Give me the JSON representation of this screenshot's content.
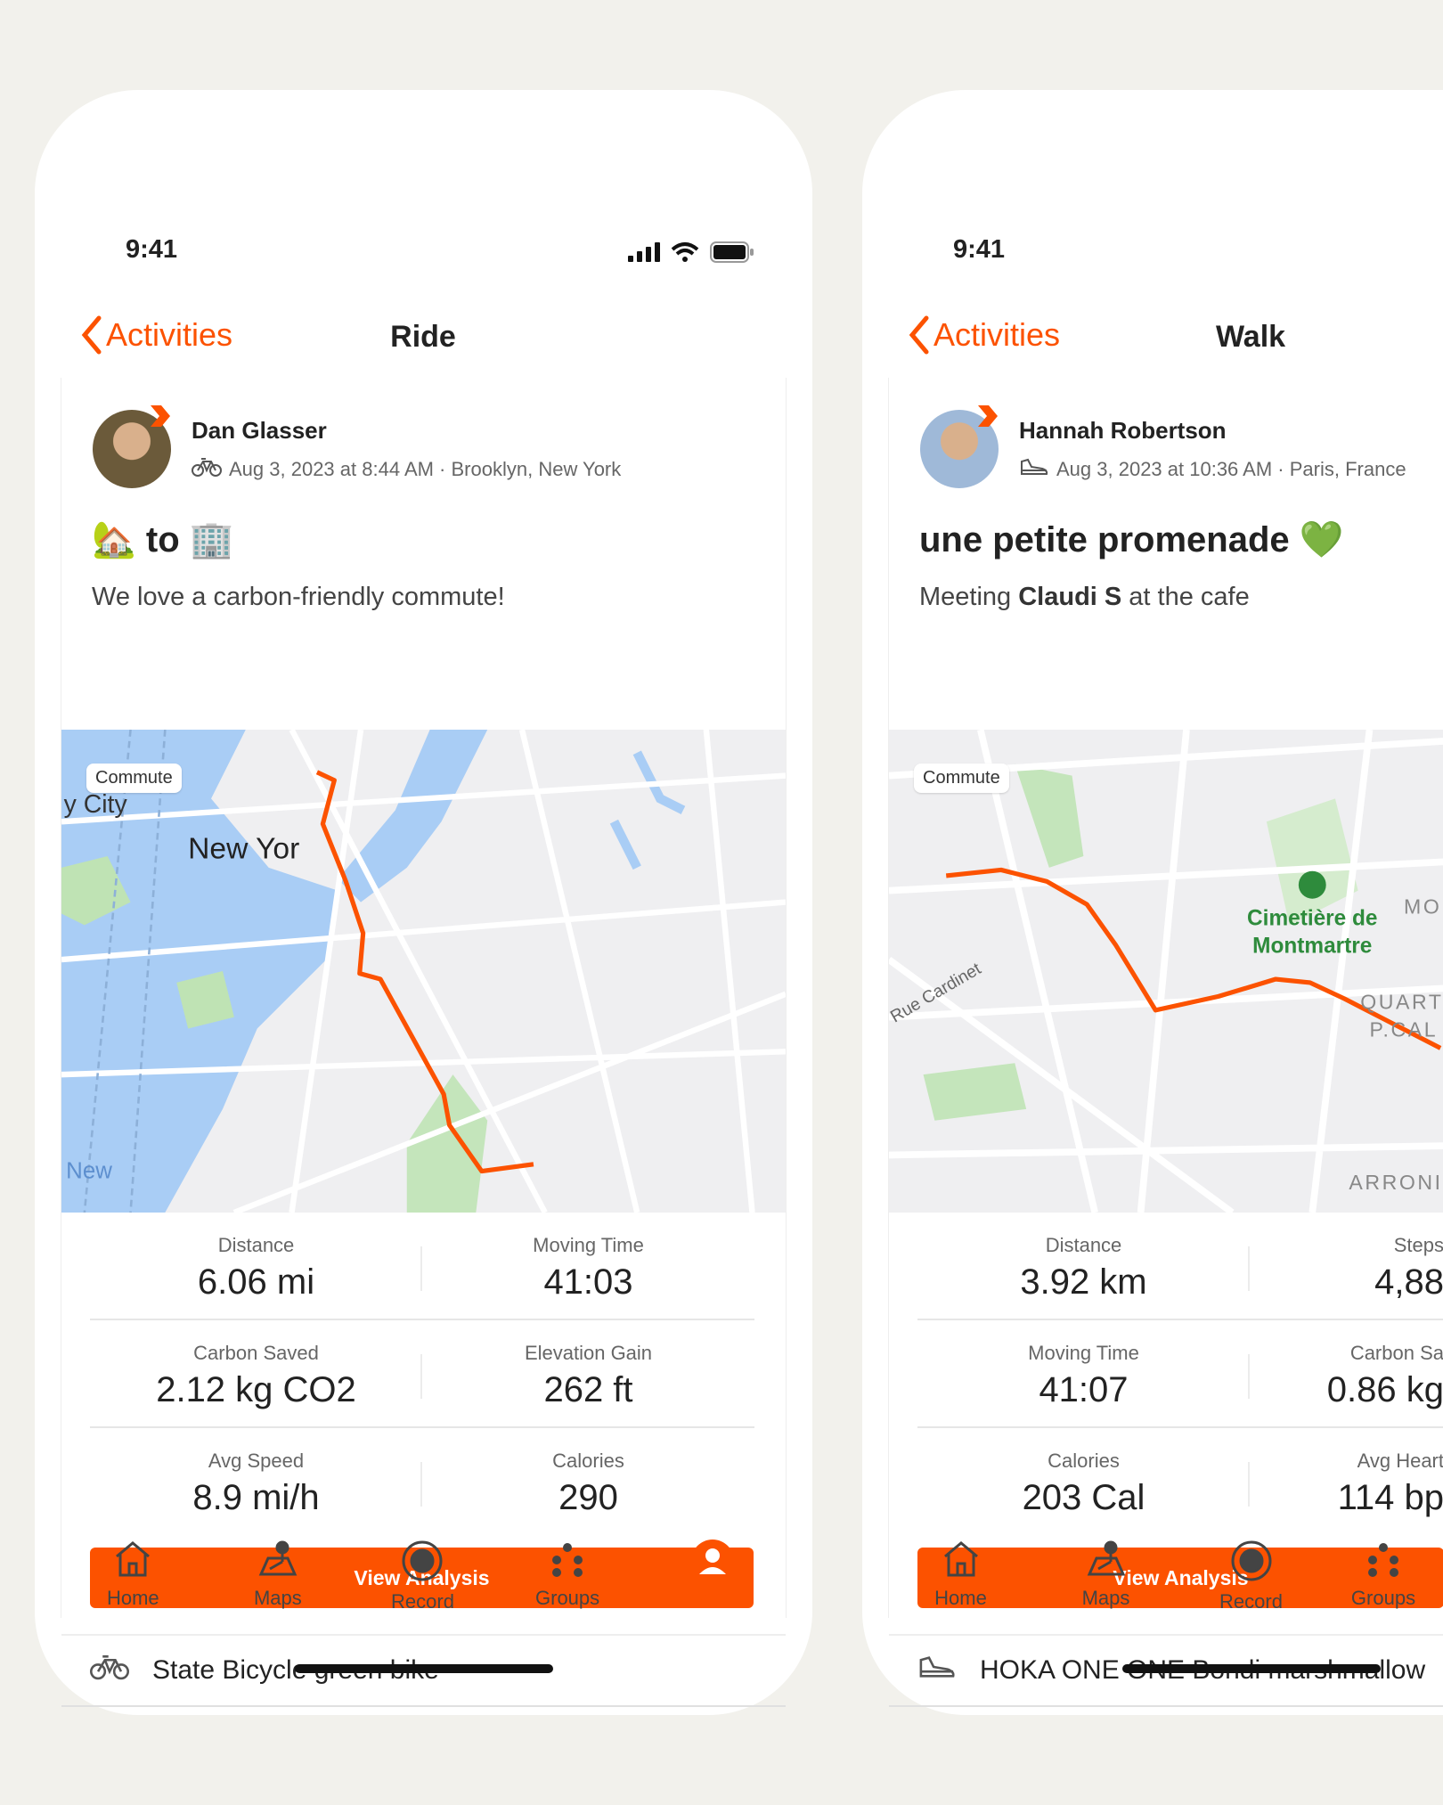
{
  "accent_color": "#fc5200",
  "background_color": "#f2f1ec",
  "phones": [
    {
      "status_time": "9:41",
      "back_label": "Activities",
      "screen_title": "Ride",
      "athlete_name": "Dan Glasser",
      "activity_icon": "bicycle-icon",
      "meta": "Aug 3, 2023 at 8:44 AM · Brooklyn, New York",
      "title": "🏡 to 🏢",
      "description": "We love a carbon-friendly commute!",
      "map_tag": "Commute",
      "map_labels": [
        "New Yor",
        "New",
        "y City"
      ],
      "stats": [
        [
          {
            "label": "Distance",
            "value": "6.06 mi"
          },
          {
            "label": "Moving Time",
            "value": "41:03"
          }
        ],
        [
          {
            "label": "Carbon Saved",
            "value": "2.12 kg CO2"
          },
          {
            "label": "Elevation Gain",
            "value": "262 ft"
          }
        ],
        [
          {
            "label": "Avg Speed",
            "value": "8.9 mi/h"
          },
          {
            "label": "Calories",
            "value": "290"
          }
        ]
      ],
      "button_label": "View Analysis",
      "gear_icon": "bicycle-icon",
      "gear": "State Bicycle green bike",
      "tabs": [
        {
          "label": "Home",
          "icon": "home-icon"
        },
        {
          "label": "Maps",
          "icon": "maps-icon"
        },
        {
          "label": "Record",
          "icon": "record-icon"
        },
        {
          "label": "Groups",
          "icon": "groups-icon"
        },
        {
          "label": "You",
          "icon": "you-icon",
          "active": true
        }
      ]
    },
    {
      "status_time": "9:41",
      "back_label": "Activities",
      "screen_title": "Walk",
      "athlete_name": "Hannah Robertson",
      "activity_icon": "shoe-icon",
      "meta": "Aug 3, 2023 at 10:36 AM · Paris, France",
      "title": "une petite promenade 💚",
      "description_prefix": "Meeting ",
      "description_mention": "Claudi S",
      "description_suffix": " at the cafe",
      "map_tag": "Commute",
      "map_labels": [
        "Cimetière de",
        "Montmartre",
        "Rue Cardinet",
        "QUART",
        "P.CAL",
        "ARRONI",
        "MO"
      ],
      "stats": [
        [
          {
            "label": "Distance",
            "value": "3.92 km"
          },
          {
            "label": "Steps",
            "value": "4,88"
          }
        ],
        [
          {
            "label": "Moving Time",
            "value": "41:07"
          },
          {
            "label": "Carbon Sa",
            "value": "0.86 kg"
          }
        ],
        [
          {
            "label": "Calories",
            "value": "203 Cal"
          },
          {
            "label": "Avg Heart",
            "value": "114 bp"
          }
        ]
      ],
      "button_label": "View Analysis",
      "gear_icon": "shoe-icon",
      "gear": "HOKA ONE ONE Bondi marshmallow",
      "tabs": [
        {
          "label": "Home",
          "icon": "home-icon"
        },
        {
          "label": "Maps",
          "icon": "maps-icon"
        },
        {
          "label": "Record",
          "icon": "record-icon"
        },
        {
          "label": "Groups",
          "icon": "groups-icon"
        }
      ]
    }
  ]
}
